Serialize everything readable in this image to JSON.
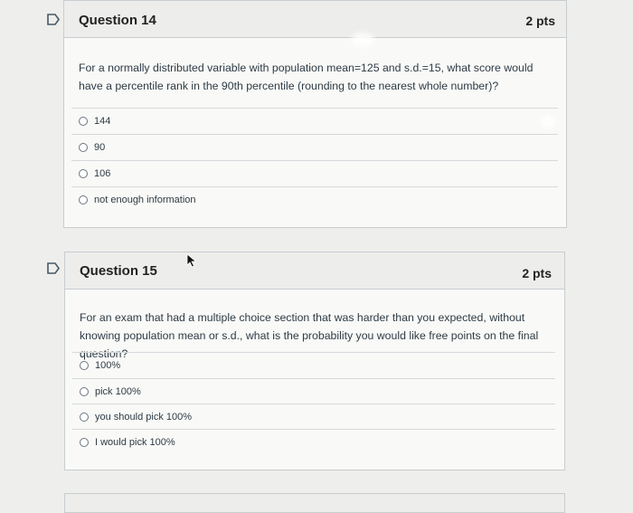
{
  "questions": [
    {
      "title": "Question 14",
      "points": "2 pts",
      "text": "For a normally distributed variable with population mean=125 and s.d.=15, what score would have a percentile rank in the 90th percentile (rounding to the nearest whole number)?",
      "answers": [
        "144",
        "90",
        "106",
        "not enough information"
      ]
    },
    {
      "title": "Question 15",
      "points": "2 pts",
      "text": "For an exam that had a multiple choice section that was harder than you expected, without knowing population mean or s.d., what is the probability you would like free points on the final question?",
      "answers": [
        "100%",
        "pick 100%",
        "you should pick 100%",
        "I would pick 100%"
      ]
    }
  ],
  "colors": {
    "flag": "#4a5963",
    "border": "#c7cdd1",
    "header_bg": "#ededeb"
  },
  "icons": {
    "flag": "flag-icon",
    "cursor": "mouse-pointer-icon"
  }
}
